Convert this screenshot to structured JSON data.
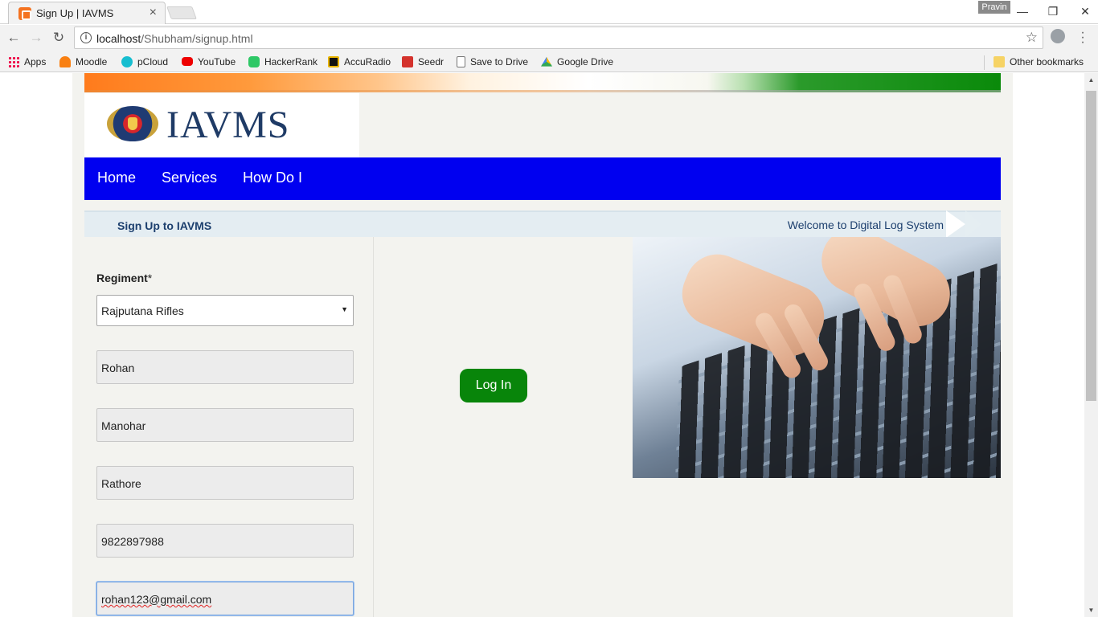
{
  "browser": {
    "tab_title": "Sign Up | IAVMS",
    "tab_close": "×",
    "profile_name": "Pravin",
    "url_host": "localhost",
    "url_path": "/Shubham/signup.html",
    "bookmarks": [
      "Apps",
      "Moodle",
      "pCloud",
      "YouTube",
      "HackerRank",
      "AccuRadio",
      "Seedr",
      "Save to Drive",
      "Google Drive"
    ],
    "other_bookmarks": "Other bookmarks",
    "icons": [
      "back-icon",
      "forward-icon",
      "reload-icon",
      "info-icon",
      "star-icon",
      "menu-icon"
    ]
  },
  "site": {
    "logo_text": "IAVMS",
    "nav": [
      "Home",
      "Services",
      "How Do I"
    ],
    "subbar_title": "Sign Up to IAVMS",
    "welcome": "Welcome to Digital Log System",
    "nav_color": "#0000f0"
  },
  "form": {
    "regiment_label": "Regiment",
    "required_mark": "*",
    "regiment_value": "Rajputana Rifles",
    "first_name": "Rohan",
    "middle_name": "Manohar",
    "last_name": "Rathore",
    "phone": "9822897988",
    "email": "rohan123@gmail.com"
  },
  "login_button": "Log In",
  "login_color": "#08850a"
}
